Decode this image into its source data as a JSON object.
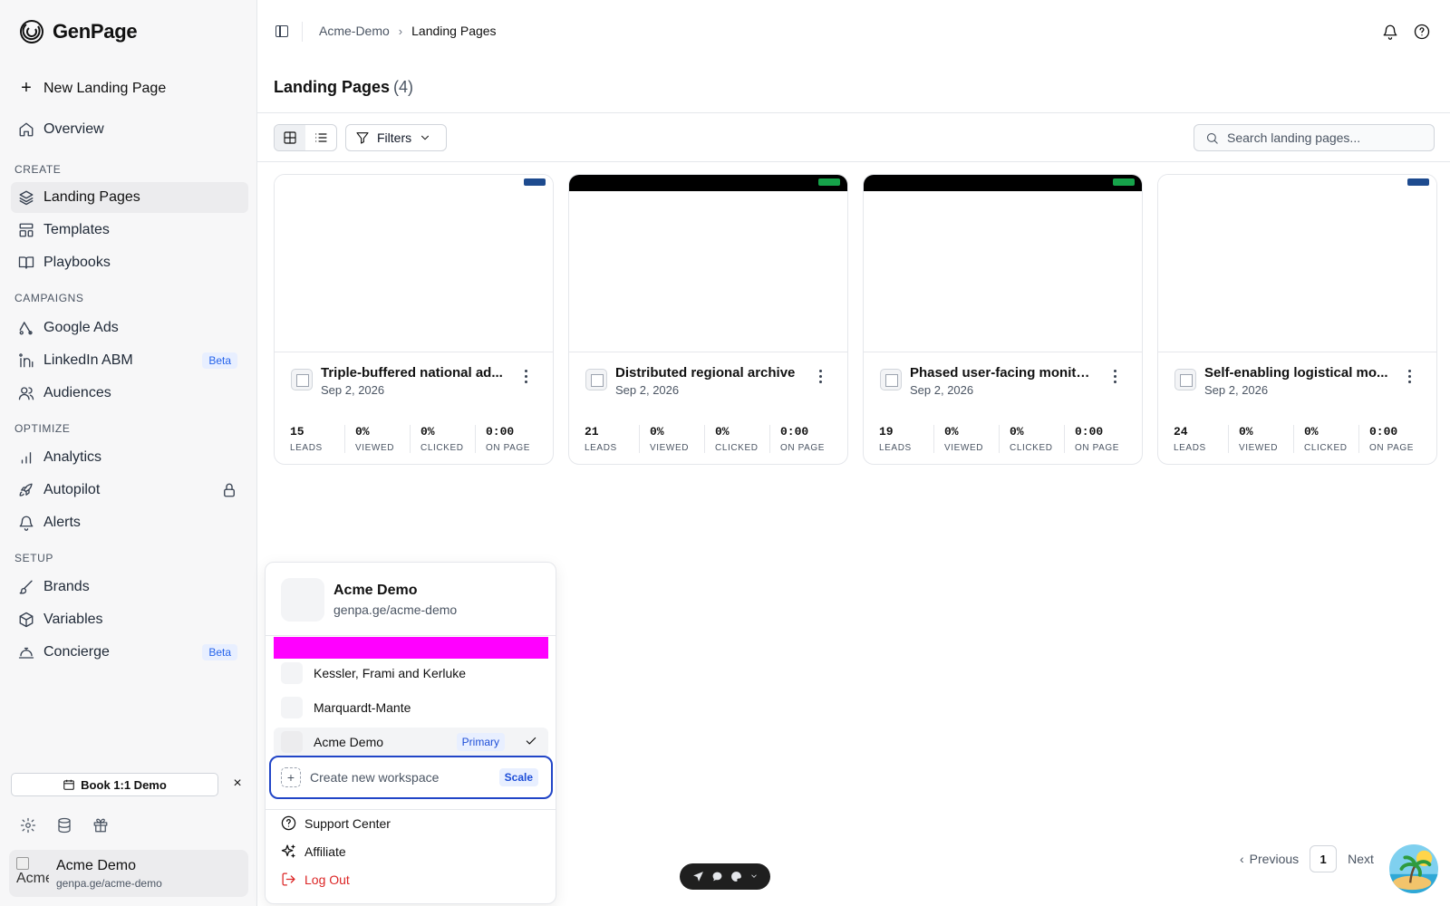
{
  "app": {
    "name": "GenPage"
  },
  "sidebar": {
    "new_button": "New Landing Page",
    "overview": "Overview",
    "sections": {
      "create": "CREATE",
      "campaigns": "CAMPAIGNS",
      "optimize": "OPTIMIZE",
      "setup": "SETUP"
    },
    "items": {
      "landing_pages": "Landing Pages",
      "templates": "Templates",
      "playbooks": "Playbooks",
      "google_ads": "Google Ads",
      "linkedin_abm": "LinkedIn ABM",
      "audiences": "Audiences",
      "analytics": "Analytics",
      "autopilot": "Autopilot",
      "alerts": "Alerts",
      "brands": "Brands",
      "variables": "Variables",
      "concierge": "Concierge"
    },
    "beta_badge": "Beta",
    "demo_button": "Book 1:1 Demo",
    "close_glyph": "×",
    "user": {
      "name": "Acme Demo",
      "url": "genpa.ge/acme-demo",
      "avatar_alt": "Acme"
    }
  },
  "topbar": {
    "breadcrumb": {
      "parent": "Acme-Demo",
      "separator": "›",
      "current": "Landing Pages"
    }
  },
  "page": {
    "title": "Landing Pages",
    "count": "(4)",
    "filters_label": "Filters",
    "search_placeholder": "Search landing pages..."
  },
  "cards": [
    {
      "title": "Triple-buffered national ad...",
      "date": "Sep 2, 2026",
      "header": "light",
      "button_color": "#1e4b8f",
      "stats": {
        "leads": "15",
        "viewed": "0%",
        "clicked": "0%",
        "on_page": "0:00"
      }
    },
    {
      "title": "Distributed regional archive",
      "date": "Sep 2, 2026",
      "header": "dark",
      "button_color": "#16a34a",
      "stats": {
        "leads": "21",
        "viewed": "0%",
        "clicked": "0%",
        "on_page": "0:00"
      }
    },
    {
      "title": "Phased user-facing monito...",
      "date": "Sep 2, 2026",
      "header": "dark",
      "button_color": "#16a34a",
      "stats": {
        "leads": "19",
        "viewed": "0%",
        "clicked": "0%",
        "on_page": "0:00"
      }
    },
    {
      "title": "Self-enabling logistical mo...",
      "date": "Sep 2, 2026",
      "header": "light",
      "button_color": "#1e4b8f",
      "stats": {
        "leads": "24",
        "viewed": "0%",
        "clicked": "0%",
        "on_page": "0:00"
      }
    }
  ],
  "stat_labels": {
    "leads": "LEADS",
    "viewed": "VIEWED",
    "clicked": "CLICKED",
    "on_page": "ON PAGE"
  },
  "workspace_menu": {
    "current": {
      "name": "Acme Demo",
      "url": "genpa.ge/acme-demo"
    },
    "workspaces": [
      {
        "name": "Kessler, Frami and Kerluke",
        "selected": false
      },
      {
        "name": "Marquardt-Mante",
        "selected": false
      },
      {
        "name": "Acme Demo",
        "selected": true,
        "badge": "Primary"
      }
    ],
    "create_label": "Create new workspace",
    "create_badge": "Scale",
    "support": "Support Center",
    "affiliate": "Affiliate",
    "logout": "Log Out"
  },
  "pagination": {
    "previous": "Previous",
    "page": "1",
    "next": "Next"
  },
  "colors": {
    "accent": "#2145c7",
    "magenta_bar": "#ff00ff",
    "danger": "#dc2626",
    "badge_blue": "#2563eb"
  }
}
